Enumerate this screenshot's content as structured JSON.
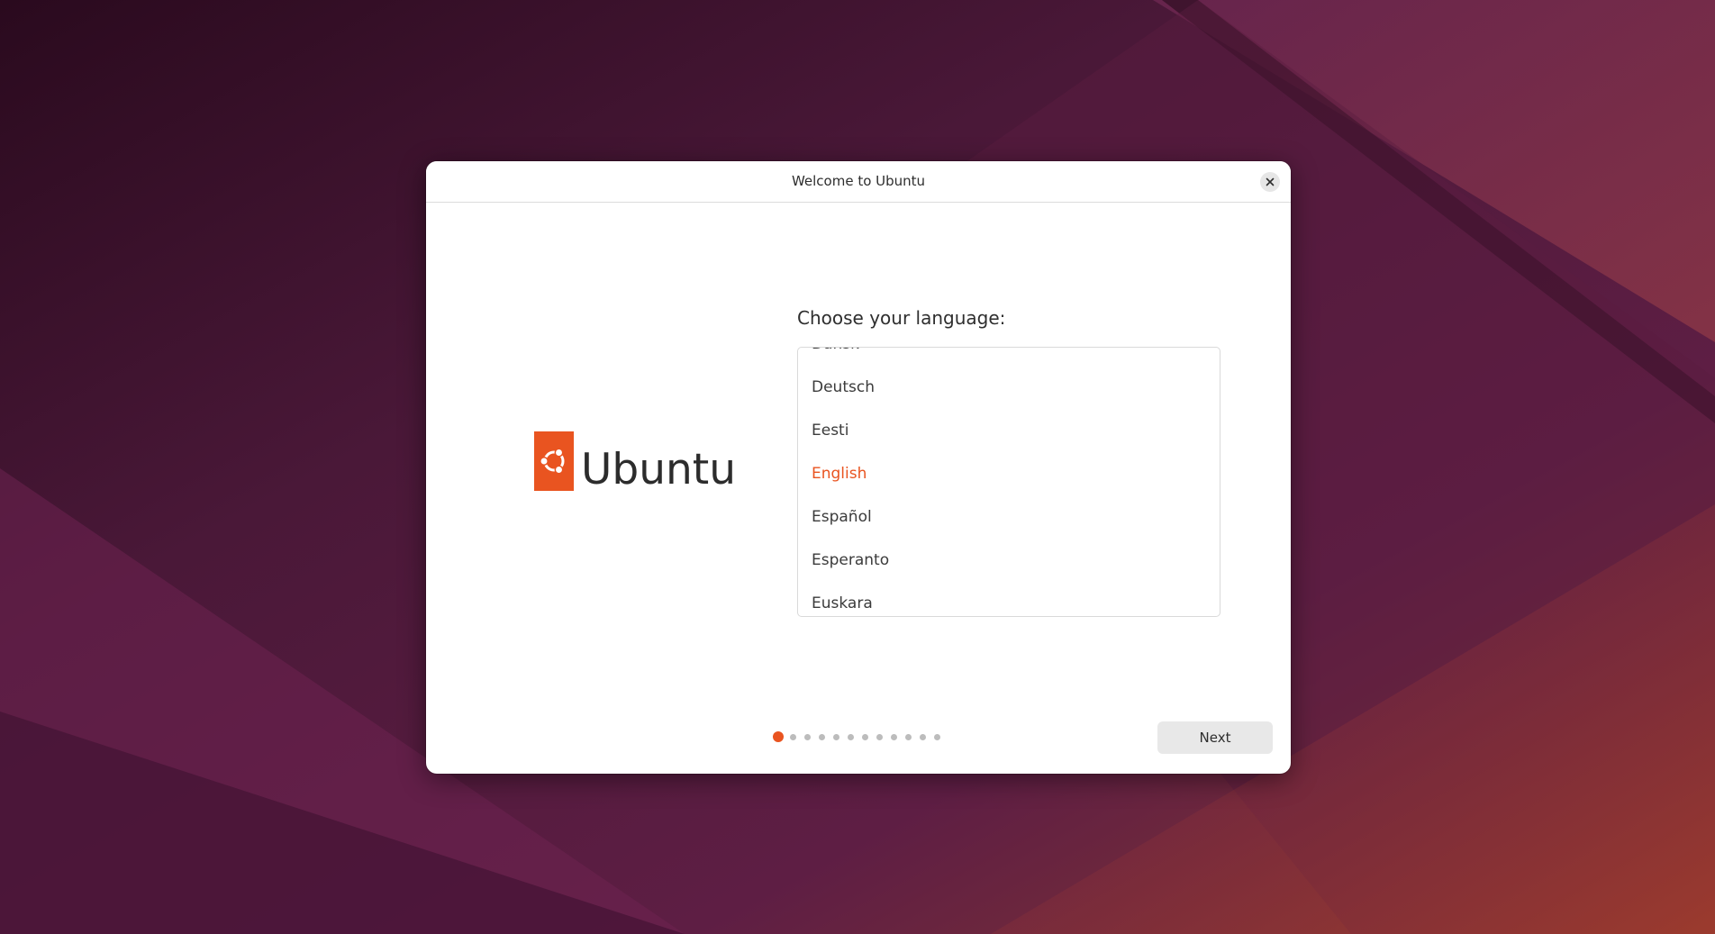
{
  "window": {
    "title": "Welcome to Ubuntu",
    "close_icon": "close-icon"
  },
  "logo": {
    "wordmark": "Ubuntu",
    "brand_color": "#e95420"
  },
  "language_page": {
    "heading": "Choose your language:",
    "languages": [
      "Dansk",
      "Deutsch",
      "Eesti",
      "English",
      "Español",
      "Esperanto",
      "Euskara"
    ],
    "selected": "English",
    "selected_color": "#e95420"
  },
  "navigation": {
    "total_steps": 12,
    "current_step": 1,
    "next_label": "Next"
  },
  "colors": {
    "wallpaper_dark": "#2c0a1f",
    "wallpaper_mid": "#5a1d42",
    "wallpaper_warm": "#8f3030"
  }
}
